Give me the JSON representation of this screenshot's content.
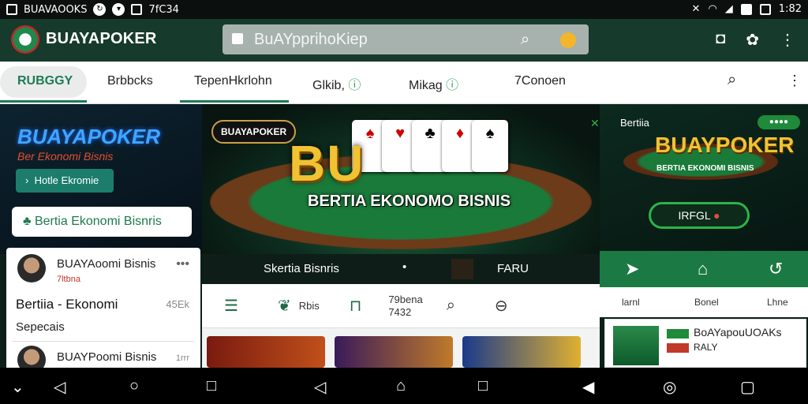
{
  "status": {
    "app_name": "BUAVAOOKS",
    "time_left": "7fC34",
    "time_right": "1:82"
  },
  "appbar": {
    "brand": "BUAYAPOKER",
    "url": "BuAYpprihoKiep"
  },
  "tabs": {
    "items": [
      "RUBGGY",
      "Brbbcks",
      "TepenHkrlohn",
      "Glkib,",
      "Mikag",
      "7Conoen"
    ]
  },
  "left_banner": {
    "title": "BUAYAPOKER",
    "subtitle": "Ber Ekonomi Bisnis",
    "button": "Hotle Ekromie",
    "pill": "Bertia  Ekonomi Bisnris"
  },
  "hero": {
    "badge": "BUAYAPOKER",
    "big": "BU",
    "text": "BERTIA  EKONOMO  BISNIS",
    "strip_left": "Skertia Bisnris",
    "strip_right": "FARU"
  },
  "right_banner": {
    "label": "Bertiia",
    "badge": "●●●●",
    "big": "BUAYPOKER",
    "sub": "BERTIA  EKONOMI  BISNIS",
    "button": "IRFGL"
  },
  "icons_row": {
    "i1": "Rbis",
    "i2": "79bena",
    "i2b": "7432"
  },
  "feed": [
    {
      "name": "BUAYAoomi Bisnis",
      "meta": "7ltbna",
      "line": "Bertiia - Ekonomi",
      "line2": "Sepecais",
      "time": "45Ek"
    },
    {
      "name": "BUAYPoomi Bisnis",
      "time": "1rrr"
    }
  ],
  "right_nav": {
    "labels": [
      "larnl",
      "Bonel",
      "Lhne"
    ]
  },
  "promo": {
    "title": "BoAYapouUOAKs",
    "sub": "RALY"
  },
  "colors": {
    "brand_green": "#1f7a57",
    "accent_red": "#e84a3a",
    "gold": "#f1c232"
  }
}
